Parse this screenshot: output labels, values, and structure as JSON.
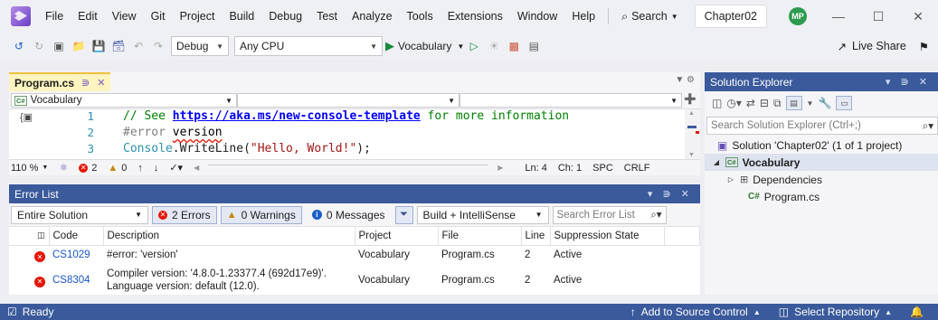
{
  "menu": [
    "File",
    "Edit",
    "View",
    "Git",
    "Project",
    "Build",
    "Debug",
    "Test",
    "Analyze",
    "Tools",
    "Extensions",
    "Window",
    "Help"
  ],
  "search_label": "Search",
  "solution_name": "Chapter02",
  "avatar_initials": "MP",
  "toolbar": {
    "config": "Debug",
    "platform": "Any CPU",
    "start_project": "Vocabulary",
    "live_share": "Live Share"
  },
  "tab": {
    "filename": "Program.cs"
  },
  "nav": {
    "project": "Vocabulary"
  },
  "code": {
    "lines": [
      {
        "num": "1",
        "comment": "// See ",
        "link": "https://aka.ms/new-console-template",
        "comment_tail": " for more information"
      },
      {
        "num": "2",
        "directive": "#error ",
        "ident": "version"
      },
      {
        "num": "3",
        "cls": "Console",
        "method": ".WriteLine(",
        "str": "\"Hello, World!\"",
        "end": ");"
      }
    ]
  },
  "editor_status": {
    "zoom": "110 %",
    "errors": "2",
    "warnings": "0",
    "position": "Ln: 4",
    "col": "Ch: 1",
    "spacing": "SPC",
    "eol": "CRLF"
  },
  "error_list": {
    "title": "Error List",
    "scope": "Entire Solution",
    "errors_btn": "2 Errors",
    "warnings_btn": "0 Warnings",
    "messages_btn": "0 Messages",
    "source": "Build + IntelliSense",
    "search_placeholder": "Search Error List",
    "columns": [
      "Code",
      "Description",
      "Project",
      "File",
      "Line",
      "Suppression State"
    ],
    "rows": [
      {
        "code": "CS1029",
        "description": "#error: 'version'",
        "description2": "",
        "project": "Vocabulary",
        "file": "Program.cs",
        "line": "2",
        "state": "Active"
      },
      {
        "code": "CS8304",
        "description": "Compiler version: '4.8.0-1.23377.4 (692d17e9)'.",
        "description2": "Language version: default (12.0).",
        "project": "Vocabulary",
        "file": "Program.cs",
        "line": "2",
        "state": "Active"
      }
    ]
  },
  "solution_explorer": {
    "title": "Solution Explorer",
    "search_placeholder": "Search Solution Explorer (Ctrl+;)",
    "solution": "Solution 'Chapter02' (1 of 1 project)",
    "project": "Vocabulary",
    "dependencies": "Dependencies",
    "file": "Program.cs"
  },
  "status": {
    "ready": "Ready",
    "source_control": "Add to Source Control",
    "repository": "Select Repository"
  },
  "colors": {
    "accent": "#3a5a9b",
    "error": "#e51400",
    "warning": "#c78700"
  }
}
